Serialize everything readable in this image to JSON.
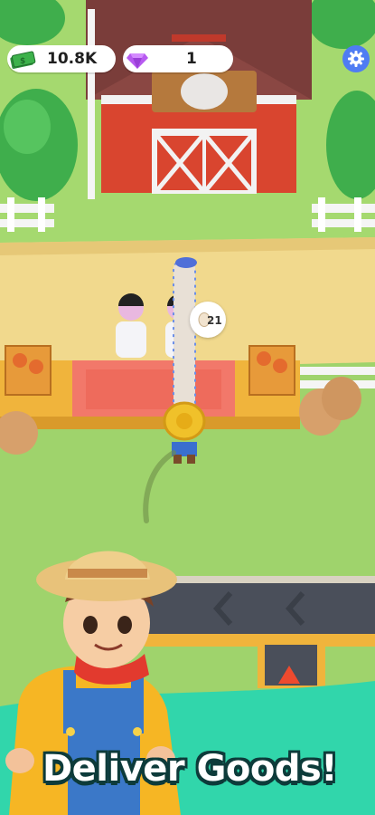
{
  "hud": {
    "cash_value": "10.8K",
    "gems_value": "1",
    "cash_icon": "cash-stack-icon",
    "gem_icon": "purple-gem-icon",
    "settings_icon": "gear-icon"
  },
  "order": {
    "quantity": "21",
    "item_icon": "egg-icon"
  },
  "banner": {
    "headline": "Deliver Goods!",
    "accent_color": "#31d6ab"
  }
}
